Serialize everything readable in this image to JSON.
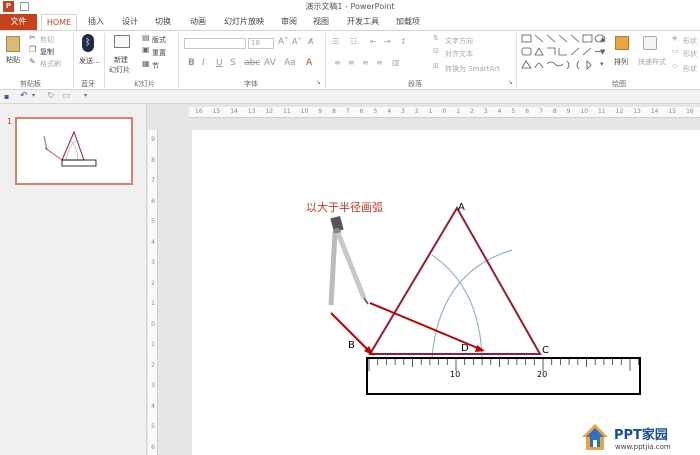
{
  "window": {
    "title": "演示文稿1 - PowerPoint",
    "app_icon_label": "P"
  },
  "tabs": [
    "文件",
    "HOME",
    "插入",
    "设计",
    "切换",
    "动画",
    "幻灯片放映",
    "审阅",
    "视图",
    "开发工具",
    "加载项"
  ],
  "ribbon": {
    "clipboard": {
      "paste": "粘贴",
      "cut": "剪切",
      "copy": "复制",
      "format_painter": "格式刷",
      "group": "剪贴板"
    },
    "bluetooth": {
      "send": "发送...",
      "group": "蓝牙"
    },
    "slides": {
      "new_slide": "新建",
      "new_slide2": "幻灯片",
      "layout": "版式",
      "reset": "重置",
      "section": "节",
      "group": "幻灯片"
    },
    "font": {
      "size": "18",
      "group": "字体"
    },
    "paragraph": {
      "text_direction": "文字方向",
      "align_text": "对齐文本",
      "smartart": "转换为 SmartArt",
      "group": "段落"
    },
    "drawing": {
      "arrange": "排列",
      "quick_styles": "快速样式",
      "shape_fill": "形状",
      "shape_outline": "形状",
      "shape_effects": "形状",
      "group": "绘图"
    }
  },
  "thumbnails": [
    {
      "number": "1"
    }
  ],
  "hruler_labels": [
    "16",
    "15",
    "14",
    "13",
    "12",
    "11",
    "10",
    "9",
    "8",
    "7",
    "6",
    "5",
    "4",
    "3",
    "2",
    "1",
    "0",
    "1",
    "2",
    "3",
    "4",
    "5",
    "6",
    "7",
    "8",
    "9",
    "10",
    "11",
    "12",
    "13",
    "14",
    "15",
    "16"
  ],
  "vruler_labels": [
    "9",
    "8",
    "7",
    "6",
    "5",
    "4",
    "3",
    "2",
    "1",
    "0",
    "1",
    "2",
    "3",
    "4",
    "5",
    "6"
  ],
  "slide": {
    "caption": "以大于半径画弧",
    "vertex_a": "A",
    "vertex_b": "B",
    "vertex_c": "C",
    "point_d": "D",
    "ruler_label_10": "10",
    "ruler_label_20": "20"
  },
  "watermark": {
    "brand": "PPT家园",
    "url": "www.pptjia.com"
  },
  "colors": {
    "accent": "#c4431c",
    "triangle": "#9b1c2a",
    "arrow": "#c00000",
    "arc": "#7faab8",
    "caption": "#c0392b"
  }
}
